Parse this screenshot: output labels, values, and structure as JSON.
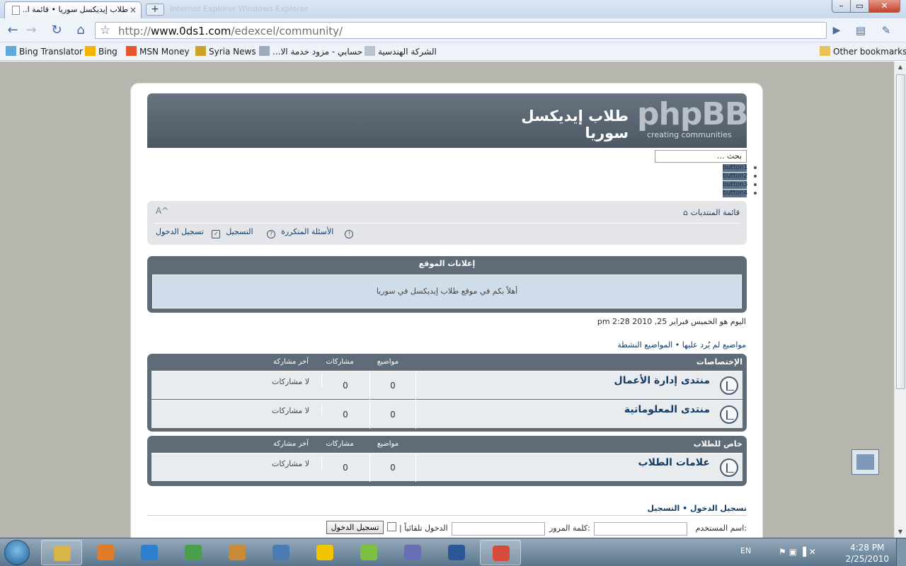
{
  "browser": {
    "tab_title": "طلاب إيديكسل سوريا • قائمة ا...",
    "tab_close": "×",
    "new_tab": "+",
    "ghost_text": "Internet Explorer    Windows Explorer",
    "url_prefix": "http://",
    "url_host": "www.0ds1.com",
    "url_path": "/edexcel/community/",
    "bookmarks": [
      "Bing Translator",
      "Bing",
      "MSN Money",
      "Syria News",
      "...حسابي - مزود خدمة الا",
      "الشركة الهندسية"
    ],
    "other_bookmarks": "Other bookmarks",
    "icons": {
      "back": "back-arrow-icon",
      "forward": "forward-arrow-icon",
      "reload": "reload-icon",
      "home": "home-icon",
      "star": "star-icon",
      "go": "play-icon",
      "page": "page-icon",
      "wrench": "wrench-icon"
    }
  },
  "site": {
    "logo_word": "phpBB",
    "logo_tag": "creating  communities",
    "title": "طلاب إيديكسل سوريا",
    "search_placeholder": "بحث ...",
    "mini_buttons": [
      "button1",
      "button2",
      "button3",
      "button4"
    ],
    "font_size_control": "A^",
    "forum_index": "قائمة المنتديات",
    "user_links": {
      "faq": "الأسئلة المتكررة",
      "register": "التسجيل",
      "login": "تسجيل الدخول"
    },
    "announcement": {
      "header": "إعلانات الموقع",
      "body": "أهلاً بكم في موقع طلاب إيديكسل في سوريا"
    },
    "date_line": "اليوم هو الخميس فبراير 25, 2010 2:28 pm",
    "quick_links": "مواضيع لم يُرد عليها • المواضيع النشطة",
    "categories": [
      {
        "name": "الإختصاصات",
        "col_topics": "مواضيع",
        "col_posts": "مشاركات",
        "col_last": "آخر مشاركة",
        "forums": [
          {
            "title": "منتدى إدارة الأعمال",
            "topics": "0",
            "posts": "0",
            "last": "لا مشاركات"
          },
          {
            "title": "منتدى المعلوماتية",
            "topics": "0",
            "posts": "0",
            "last": "لا مشاركات"
          }
        ]
      },
      {
        "name": "خاص للطلاب",
        "col_topics": "مواضيع",
        "col_posts": "مشاركات",
        "col_last": "آخر مشاركة",
        "forums": [
          {
            "title": "علامات الطلاب",
            "topics": "0",
            "posts": "0",
            "last": "لا مشاركات"
          }
        ]
      }
    ],
    "login_box": {
      "links": "تسجيل الدخول  •  التسجيل",
      "username_label": "اسم المستخدم:",
      "password_label": "كلمة المرور:",
      "autologin_label": "| الدخول تلقائياً",
      "submit": "تسجيل الدخول"
    }
  },
  "taskbar": {
    "lang": "EN",
    "time": "4:28 PM",
    "date": "2/25/2010",
    "apps": [
      "explorer-icon",
      "media-player-icon",
      "internet-explorer-icon",
      "messenger-icon",
      "mail-icon",
      "virtualbox-icon",
      "mtn-icon",
      "app-icon",
      "remote-icon",
      "word-icon",
      "chrome-icon"
    ],
    "app_colors": [
      "#d9b44a",
      "#e07b2a",
      "#2f7fd1",
      "#4aa04a",
      "#c98b3a",
      "#4b7bb3",
      "#f2c400",
      "#7cc142",
      "#6a6fb5",
      "#2b5797",
      "#d64b3b"
    ]
  }
}
